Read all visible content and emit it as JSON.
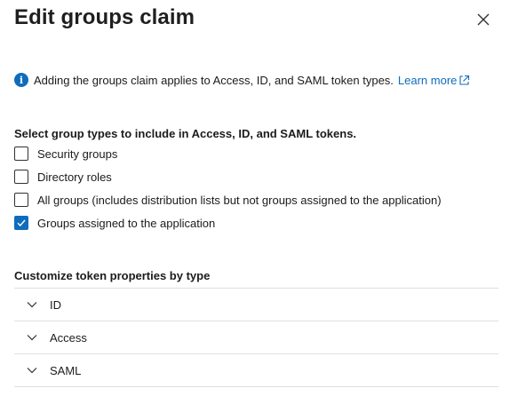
{
  "header": {
    "title": "Edit groups claim"
  },
  "info": {
    "text": "Adding the groups claim applies to Access, ID, and SAML token types.",
    "link": "Learn more"
  },
  "group_types": {
    "label": "Select group types to include in Access, ID, and SAML tokens.",
    "options": [
      {
        "label": "Security groups",
        "checked": false
      },
      {
        "label": "Directory roles",
        "checked": false
      },
      {
        "label": "All groups (includes distribution lists but not groups assigned to the application)",
        "checked": false
      },
      {
        "label": "Groups assigned to the application",
        "checked": true
      }
    ]
  },
  "customize": {
    "label": "Customize token properties by type",
    "items": [
      {
        "label": "ID"
      },
      {
        "label": "Access"
      },
      {
        "label": "SAML"
      }
    ]
  },
  "colors": {
    "accent": "#0f6cbd",
    "divider": "#e1dfdd",
    "text": "#1b1b1b"
  },
  "icons": [
    "close-icon",
    "info-icon",
    "external-link-icon",
    "checkmark-icon",
    "chevron-down-icon"
  ]
}
